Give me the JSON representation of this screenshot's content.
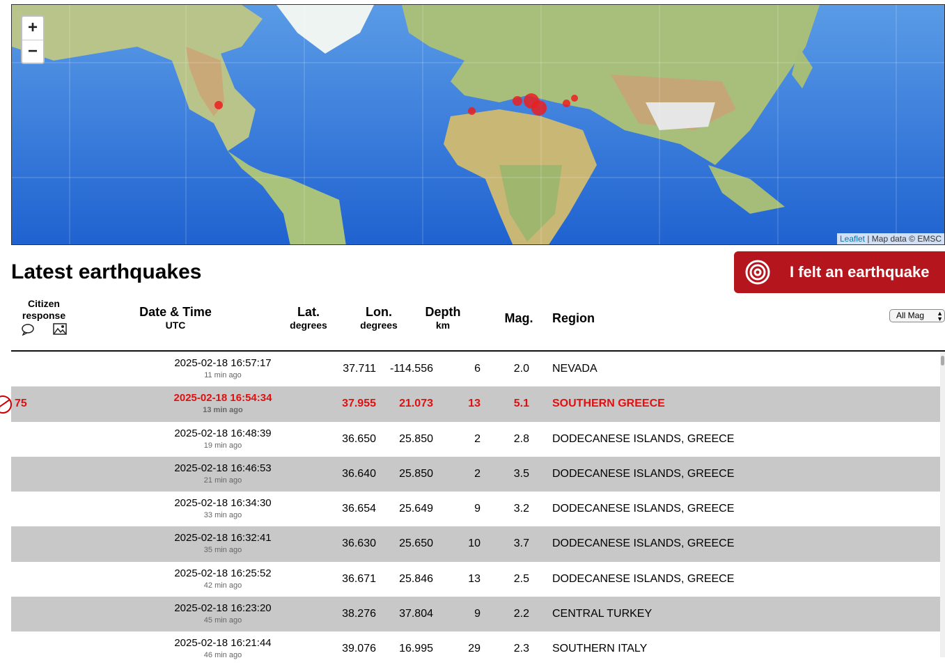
{
  "map": {
    "zoom_in": "+",
    "zoom_out": "−",
    "attribution_link": "Leaflet",
    "attribution_text": " | Map data © EMSC",
    "marker_color": "#eb1e1e",
    "markers": [
      {
        "location": "Nevada",
        "size": "small"
      },
      {
        "location": "Morocco",
        "size": "small"
      },
      {
        "location": "Southern Greece",
        "size": "large"
      },
      {
        "location": "Dodecanese",
        "size": "large"
      },
      {
        "location": "Aegean",
        "size": "medium"
      },
      {
        "location": "Central Turkey",
        "size": "small"
      },
      {
        "location": "Eastern Turkey",
        "size": "small"
      }
    ]
  },
  "header": {
    "title": "Latest earthquakes",
    "felt_button": "I felt an earthquake"
  },
  "table": {
    "citizen_response_label": "Citizen response",
    "col_datetime": "Date & Time",
    "col_datetime_sub": "UTC",
    "col_lat": "Lat.",
    "col_lat_sub": "degrees",
    "col_lon": "Lon.",
    "col_lon_sub": "degrees",
    "col_depth": "Depth",
    "col_depth_sub": "km",
    "col_mag": "Mag.",
    "col_region": "Region",
    "mag_filter": "All Mag",
    "highlight_color": "#e01010",
    "rows": [
      {
        "datetime": "2025-02-18 16:57:17",
        "ago": "11 min ago",
        "lat": "37.711",
        "lon": "-114.556",
        "depth": "6",
        "mag": "2.0",
        "region": "NEVADA",
        "count": ""
      },
      {
        "datetime": "2025-02-18 16:54:34",
        "ago": "13 min ago",
        "lat": "37.955",
        "lon": "21.073",
        "depth": "13",
        "mag": "5.1",
        "region": "SOUTHERN GREECE",
        "count": "75"
      },
      {
        "datetime": "2025-02-18 16:48:39",
        "ago": "19 min ago",
        "lat": "36.650",
        "lon": "25.850",
        "depth": "2",
        "mag": "2.8",
        "region": "DODECANESE ISLANDS, GREECE",
        "count": ""
      },
      {
        "datetime": "2025-02-18 16:46:53",
        "ago": "21 min ago",
        "lat": "36.640",
        "lon": "25.850",
        "depth": "2",
        "mag": "3.5",
        "region": "DODECANESE ISLANDS, GREECE",
        "count": ""
      },
      {
        "datetime": "2025-02-18 16:34:30",
        "ago": "33 min ago",
        "lat": "36.654",
        "lon": "25.649",
        "depth": "9",
        "mag": "3.2",
        "region": "DODECANESE ISLANDS, GREECE",
        "count": ""
      },
      {
        "datetime": "2025-02-18 16:32:41",
        "ago": "35 min ago",
        "lat": "36.630",
        "lon": "25.650",
        "depth": "10",
        "mag": "3.7",
        "region": "DODECANESE ISLANDS, GREECE",
        "count": ""
      },
      {
        "datetime": "2025-02-18 16:25:52",
        "ago": "42 min ago",
        "lat": "36.671",
        "lon": "25.846",
        "depth": "13",
        "mag": "2.5",
        "region": "DODECANESE ISLANDS, GREECE",
        "count": ""
      },
      {
        "datetime": "2025-02-18 16:23:20",
        "ago": "45 min ago",
        "lat": "38.276",
        "lon": "37.804",
        "depth": "9",
        "mag": "2.2",
        "region": "CENTRAL TURKEY",
        "count": ""
      },
      {
        "datetime": "2025-02-18 16:21:44",
        "ago": "46 min ago",
        "lat": "39.076",
        "lon": "16.995",
        "depth": "29",
        "mag": "2.3",
        "region": "SOUTHERN ITALY",
        "count": ""
      }
    ]
  }
}
